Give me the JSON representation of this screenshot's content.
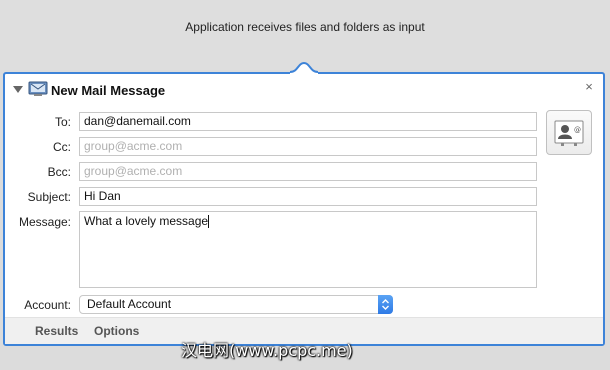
{
  "banner": {
    "text": "Application receives files and folders as input"
  },
  "action": {
    "title": "New Mail Message",
    "close_symbol": "×",
    "icons": [
      "disclosure-triangle-icon",
      "mail-app-icon",
      "close-icon",
      "address-card-icon",
      "popup-arrows-icon"
    ],
    "fields": {
      "to": {
        "label": "To:",
        "value": "dan@danemail.com",
        "placeholder": ""
      },
      "cc": {
        "label": "Cc:",
        "value": "",
        "placeholder": "group@acme.com"
      },
      "bcc": {
        "label": "Bcc:",
        "value": "",
        "placeholder": "group@acme.com"
      },
      "subject": {
        "label": "Subject:",
        "value": "Hi Dan",
        "placeholder": ""
      },
      "message": {
        "label": "Message:",
        "value": "What a lovely message"
      },
      "account": {
        "label": "Account:",
        "value": "Default Account"
      }
    },
    "tabs": [
      "Results",
      "Options"
    ]
  },
  "watermark": {
    "text": "汉电网(www.pcpc.me)"
  },
  "colors": {
    "accent": "#3d83d8",
    "popup_blue": "#2e7ae6",
    "background": "#dcdcdc"
  }
}
